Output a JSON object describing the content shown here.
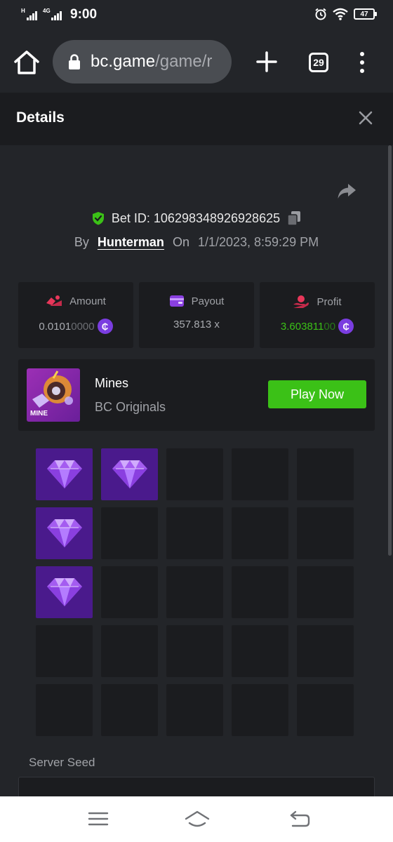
{
  "status_bar": {
    "time": "9:00",
    "signal_1_label": "H",
    "signal_2_label": "4G",
    "battery": "47",
    "icons": [
      "alarm-icon",
      "wifi-icon",
      "battery-icon"
    ]
  },
  "browser": {
    "url_domain": "bc.game",
    "url_path": "/game/r",
    "tab_count": "29",
    "icons": [
      "home-icon",
      "lock-icon",
      "plus-icon",
      "tabs-icon",
      "more-vert-icon"
    ]
  },
  "details": {
    "title": "Details"
  },
  "bet": {
    "id_label": "Bet ID: 106298348926928625",
    "by_label": "By",
    "username": "Hunterman",
    "on_label": "On",
    "date": "1/1/2023, 8:59:29 PM"
  },
  "stats": {
    "amount": {
      "label": "Amount",
      "value_bright": "0.0101",
      "value_dim": "0000"
    },
    "payout": {
      "label": "Payout",
      "value": "357.813 x"
    },
    "profit": {
      "label": "Profit",
      "value_bright": "3.603811",
      "value_dim": "00"
    }
  },
  "coin_symbol": "₵",
  "game": {
    "name": "Mines",
    "provider": "BC Originals",
    "thumb_label": "MINE",
    "play_label": "Play Now"
  },
  "mines_grid": [
    [
      1,
      1,
      0,
      0,
      0
    ],
    [
      1,
      0,
      0,
      0,
      0
    ],
    [
      1,
      0,
      0,
      0,
      0
    ],
    [
      0,
      0,
      0,
      0,
      0
    ],
    [
      0,
      0,
      0,
      0,
      0
    ]
  ],
  "server_seed": {
    "label": "Server Seed"
  },
  "colors": {
    "accent_green": "#3bc117",
    "gem_tile": "#4a1a8c",
    "panel": "#1b1c1f",
    "background": "#232529"
  }
}
